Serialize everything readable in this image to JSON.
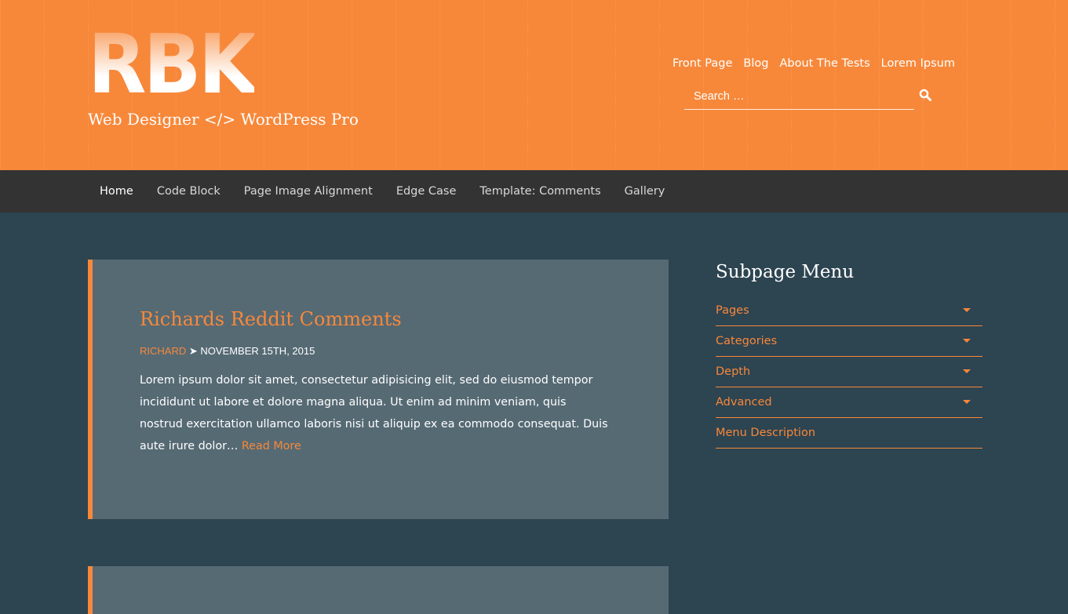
{
  "header": {
    "logo_text": "RBK",
    "tagline": "Web Designer </> WordPress Pro",
    "top_nav": [
      "Front Page",
      "Blog",
      "About The Tests",
      "Lorem Ipsum"
    ],
    "search": {
      "placeholder": "Search …",
      "icon": "search-icon"
    }
  },
  "main_nav": {
    "items": [
      "Home",
      "Code Block",
      "Page Image Alignment",
      "Edge Case",
      "Template: Comments",
      "Gallery"
    ],
    "active": "Home"
  },
  "post": {
    "title": "Richards Reddit Comments",
    "author": "RICHARD",
    "separator": "➤",
    "date": "NOVEMBER 15TH, 2015",
    "excerpt": "Lorem ipsum dolor sit amet, consectetur adipisicing elit, sed do eiusmod tempor incididunt ut labore et dolore magna aliqua. Ut enim ad minim veniam, quis nostrud exercitation ullamco laboris nisi ut aliquip ex ea commodo consequat. Duis aute irure dolor…",
    "read_more": "Read More"
  },
  "sidebar": {
    "title": "Subpage Menu",
    "items": [
      {
        "label": "Pages",
        "has_children": true
      },
      {
        "label": "Categories",
        "has_children": true
      },
      {
        "label": "Depth",
        "has_children": true
      },
      {
        "label": "Advanced",
        "has_children": true
      },
      {
        "label": "Menu Description",
        "has_children": false
      }
    ]
  },
  "colors": {
    "accent": "#f7883a",
    "header_bg": "#f7883a",
    "nav_bg": "#333333",
    "page_bg": "#2d4451",
    "card_bg": "#566a74"
  }
}
